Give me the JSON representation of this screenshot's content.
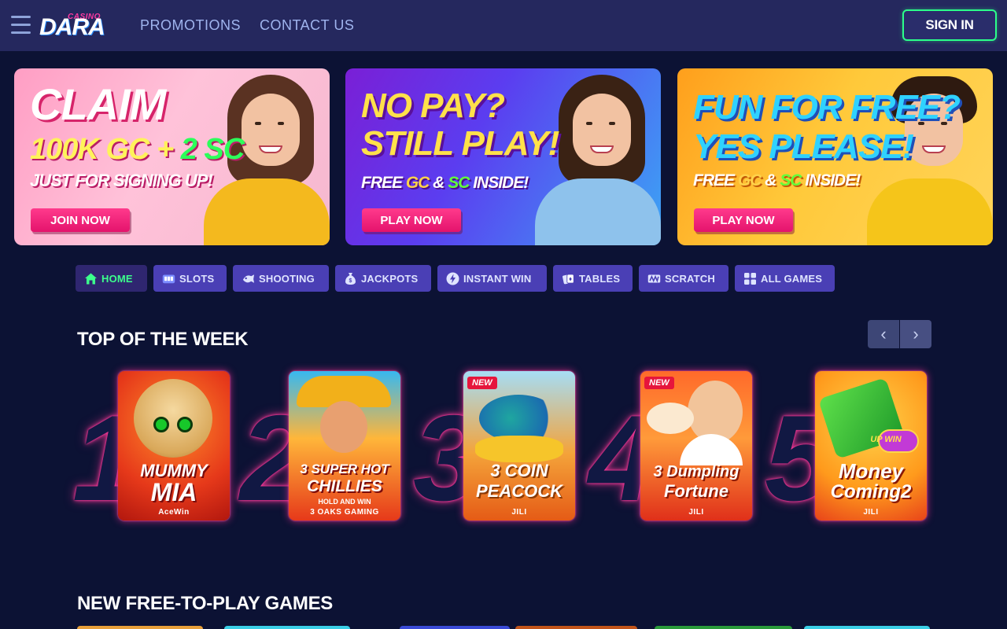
{
  "header": {
    "logo_small": "CASINO",
    "logo_main": "DARA",
    "nav": [
      "PROMOTIONS",
      "CONTACT US"
    ],
    "signin_label": "SIGN IN"
  },
  "banners": [
    {
      "line1": "CLAIM",
      "line2a": "100K GC + ",
      "line2b": "2 SC",
      "line3": "JUST FOR SIGNING UP!",
      "cta": "JOIN NOW"
    },
    {
      "line1": "NO PAY?",
      "line2": "STILL PLAY!",
      "line3a": "FREE ",
      "line3b": "GC",
      "line3c": " & ",
      "line3d": "SC",
      "line3e": " INSIDE!",
      "cta": "PLAY NOW"
    },
    {
      "line1": "FUN FOR FREE?",
      "line2": "YES PLEASE!",
      "line3a": "FREE ",
      "line3b": "GC",
      "line3c": " & ",
      "line3d": "SC",
      "line3e": " INSIDE!",
      "cta": "PLAY NOW"
    }
  ],
  "categories": [
    {
      "label": "HOME",
      "icon": "home-icon"
    },
    {
      "label": "SLOTS",
      "icon": "slot-machine-icon"
    },
    {
      "label": "SHOOTING",
      "icon": "fish-icon"
    },
    {
      "label": "JACKPOTS",
      "icon": "money-bag-icon"
    },
    {
      "label": "INSTANT WIN",
      "icon": "lightning-icon"
    },
    {
      "label": "TABLES",
      "icon": "cards-icon"
    },
    {
      "label": "SCRATCH",
      "icon": "scratch-icon"
    },
    {
      "label": "ALL GAMES",
      "icon": "grid-icon"
    }
  ],
  "top_week": {
    "title": "TOP OF THE WEEK",
    "games": [
      {
        "rank": "1",
        "title_a": "MUMMY",
        "title_b": "MIA",
        "provider": "AceWin",
        "badge": ""
      },
      {
        "rank": "2",
        "title_a": "3 SUPER HOT",
        "title_b": "CHILLIES",
        "subtitle": "HOLD AND WIN",
        "provider": "3 OAKS GAMING",
        "badge": ""
      },
      {
        "rank": "3",
        "title_a": "3 COIN",
        "title_b": "PEACOCK",
        "provider": "JILI",
        "badge": "NEW"
      },
      {
        "rank": "4",
        "title_a": "3 Dumpling",
        "title_b": "Fortune",
        "provider": "JILI",
        "badge": "NEW"
      },
      {
        "rank": "5",
        "title_a": "Money",
        "title_b": "Coming2",
        "badge_up": "UP WIN",
        "provider": "JILI",
        "badge": ""
      }
    ]
  },
  "new_games": {
    "title": "NEW FREE-TO-PLAY GAMES"
  },
  "colors": {
    "bg": "#0c1234",
    "header": "#25285e",
    "accent_green": "#2cff8a",
    "accent_pink": "#ff3a9a",
    "category": "#4a3fb5"
  }
}
